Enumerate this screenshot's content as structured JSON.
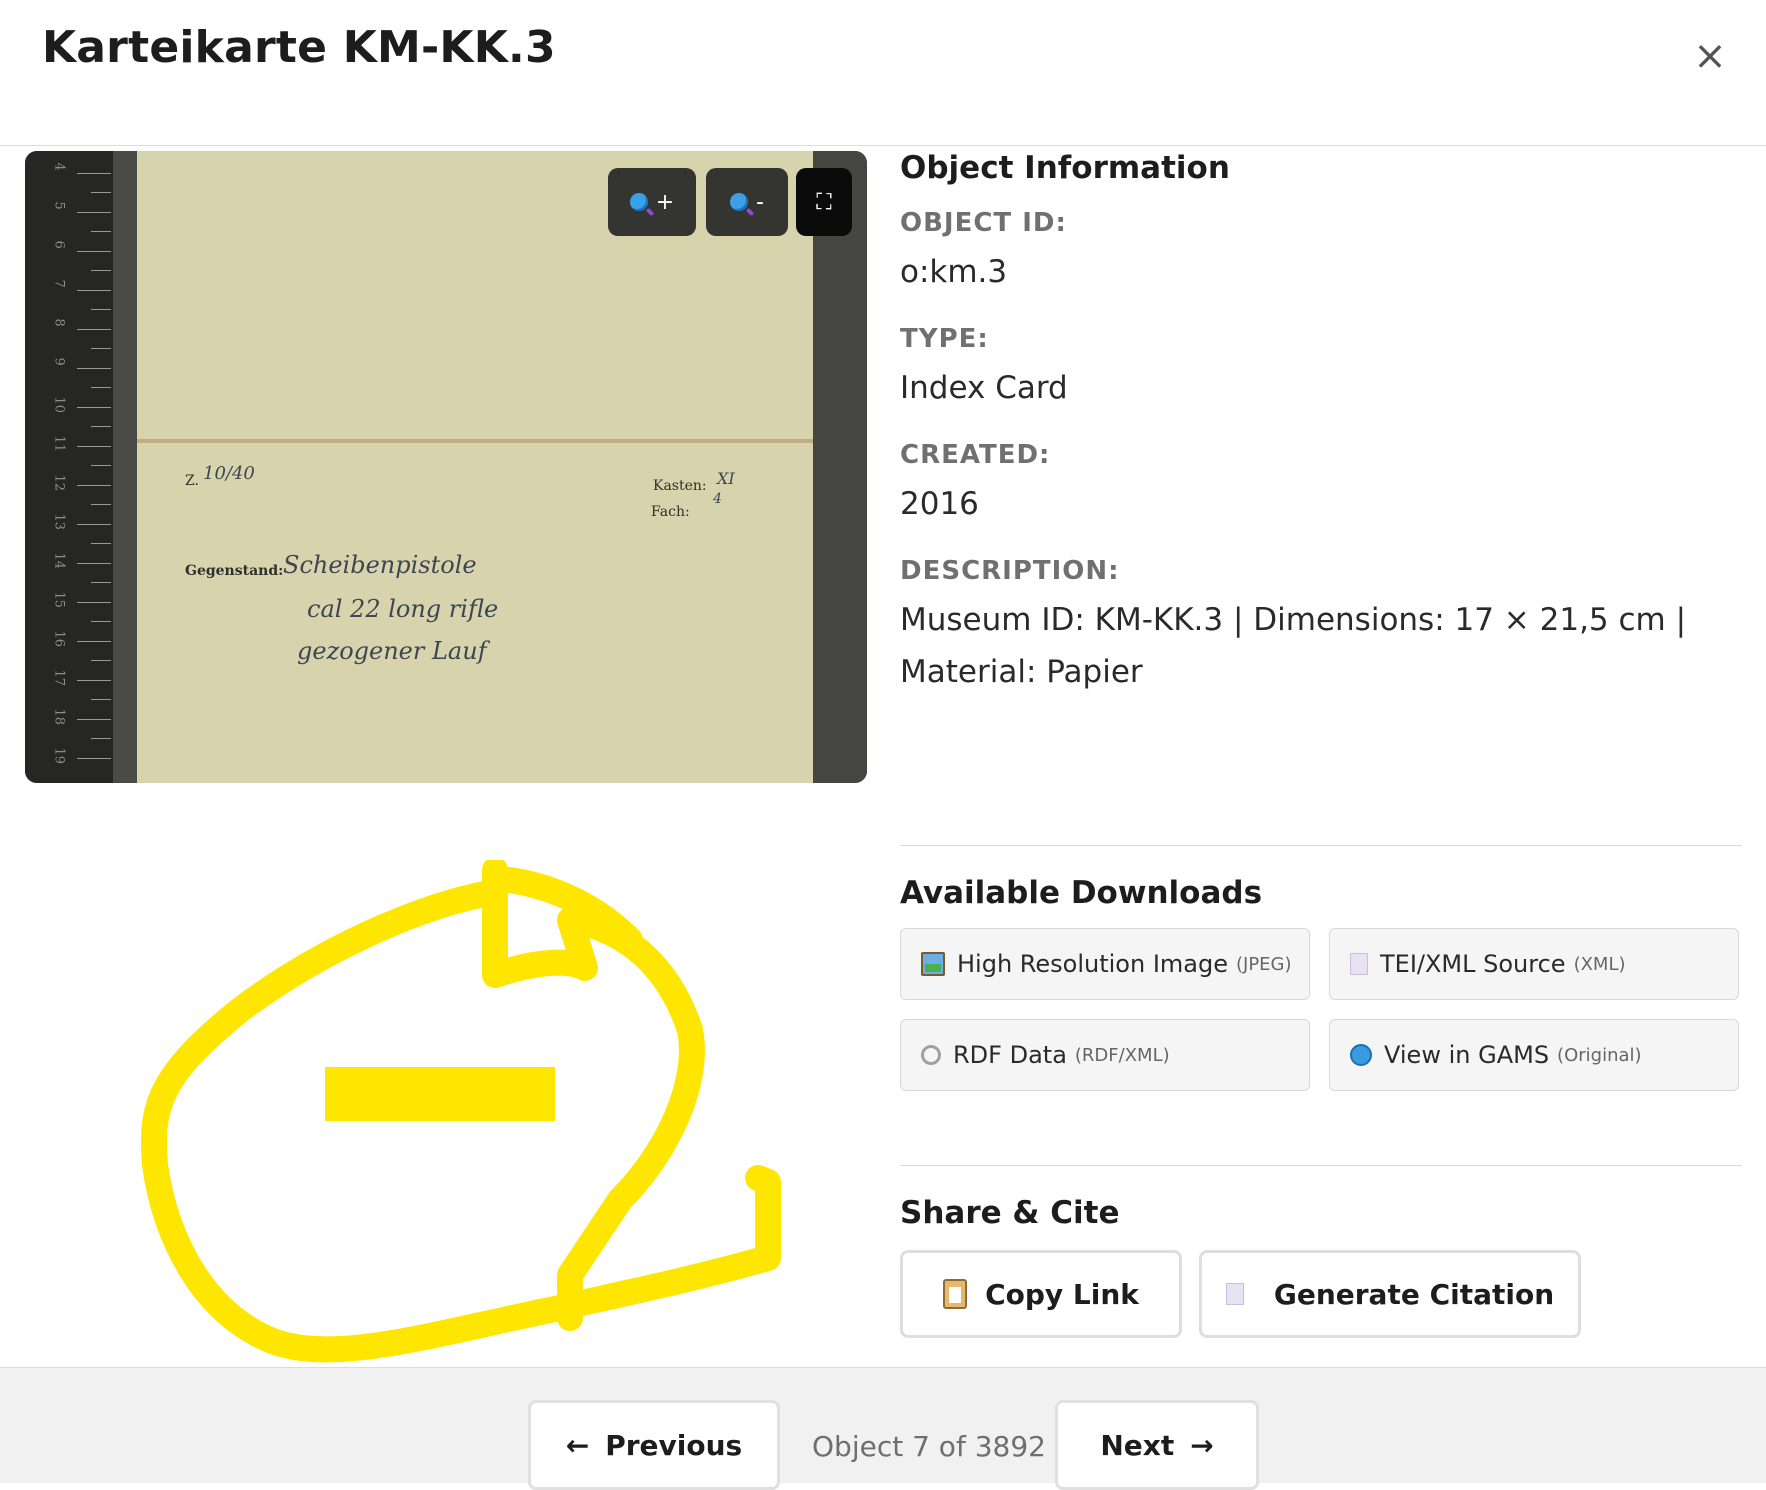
{
  "modal": {
    "title": "Karteikarte KM-KK.3",
    "close_symbol": "×"
  },
  "viewer": {
    "zoom_in_label": "+",
    "zoom_out_label": "-",
    "fullscreen_symbol": "⛶",
    "card": {
      "z_label": "Z.",
      "z_value": "10/40",
      "kasten_label": "Kasten:",
      "kasten_value": "XI",
      "fach_label": "Fach:",
      "fach_value": "4",
      "gegenstand_label": "Gegenstand:",
      "handwriting": [
        "Scheibenpistole",
        "cal 22 long rifle",
        "gezogener Lauf"
      ]
    },
    "ruler_numbers": [
      "4",
      "5",
      "6",
      "7",
      "8",
      "9",
      "10",
      "11",
      "12",
      "13",
      "14",
      "15",
      "16",
      "17",
      "18",
      "19"
    ]
  },
  "object_info": {
    "heading": "Object Information",
    "fields": [
      {
        "label": "OBJECT ID:",
        "value": "o:km.3"
      },
      {
        "label": "TYPE:",
        "value": "Index Card"
      },
      {
        "label": "CREATED:",
        "value": "2016"
      },
      {
        "label": "DESCRIPTION:",
        "value": "Museum ID: KM-KK.3 | Dimensions: 17 × 21,5 cm | Material: Papier"
      }
    ]
  },
  "downloads": {
    "heading": "Available Downloads",
    "items": [
      {
        "label": "High Resolution Image",
        "format": "(JPEG)",
        "icon": "image-icon"
      },
      {
        "label": "TEI/XML Source",
        "format": "(XML)",
        "icon": "document-icon"
      },
      {
        "label": "RDF Data",
        "format": "(RDF/XML)",
        "icon": "link-icon"
      },
      {
        "label": "View in GAMS",
        "format": "(Original)",
        "icon": "globe-icon"
      }
    ]
  },
  "share": {
    "heading": "Share & Cite",
    "copy_link": "Copy Link",
    "generate_citation": "Generate Citation"
  },
  "pagination": {
    "previous": "Previous",
    "previous_arrow": "←",
    "counter": "Object 7 of 3892",
    "next": "Next",
    "next_arrow": "→"
  },
  "colors": {
    "annotation": "#FFE600",
    "card": "#D7D3AD"
  }
}
